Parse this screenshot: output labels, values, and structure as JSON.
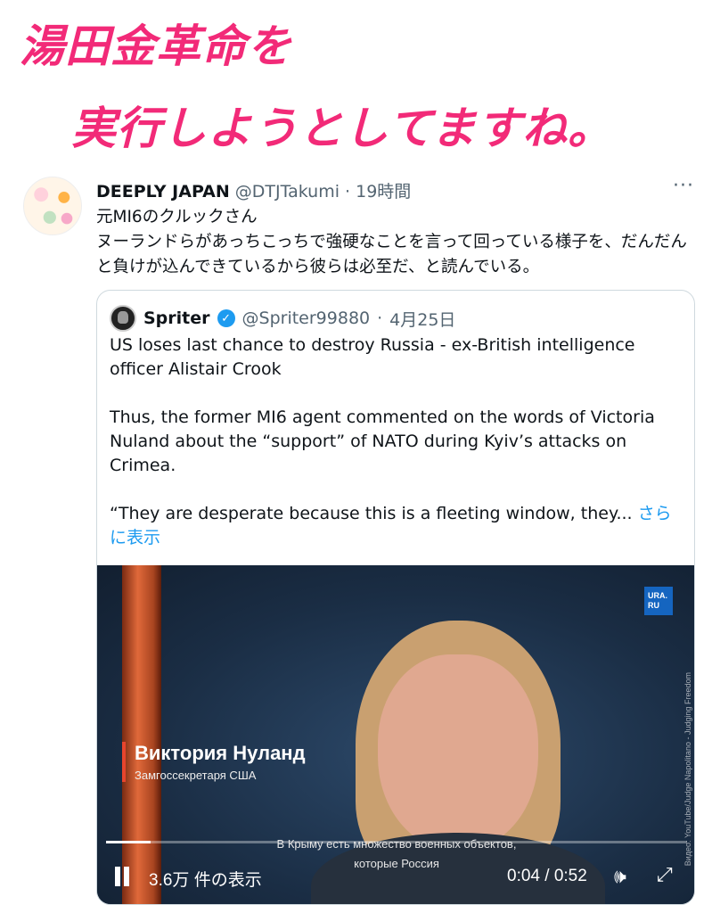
{
  "caption": {
    "line1": "湯田金革命を",
    "line2": "実行しようとしてますね。"
  },
  "tweet": {
    "author_name": "DEEPLY JAPAN",
    "author_handle": "@DTJTakumi",
    "separator": " · ",
    "time": "19時間",
    "more_icon": "···",
    "text_line1": "元MI6のクルックさん",
    "text_line2": "ヌーランドらがあっちこっちで強硬なことを言って回っている様子を、だんだんと負けが込んできているから彼らは必至だ、と読んでいる。"
  },
  "quote": {
    "author_name": "Spriter",
    "author_handle": "@Spriter99880",
    "separator": " · ",
    "date": "4月25日",
    "paragraph1": "US loses last chance to destroy Russia - ex-British intelligence officer Alistair Crook",
    "paragraph2": "Thus, the former MI6 agent commented on the words of Victoria Nuland about the “support” of NATO during Kyiv’s attacks on Crimea.",
    "paragraph3": " “They are desperate because this is a fleeting window, they... ",
    "more_link": "さらに表示"
  },
  "video": {
    "logo_text_1": "URA.",
    "logo_text_2": "RU",
    "lower_third_name": "Виктория Нуланд",
    "lower_third_title": "Замгоссекретаря США",
    "side_credit": "Видео: YouTube/Judge Napolitano - Judging Freedom",
    "subtitle_line1": "В Крыму есть множество военных объектов,",
    "subtitle_line2": "которые Россия",
    "progress_fraction": 0.077,
    "views": "3.6万 件の表示",
    "time": "0:04 / 0:52",
    "volume_icon": "🕪",
    "fullscreen_icon": "⤢"
  },
  "colors": {
    "caption": "#f22a78",
    "link": "#1d9bf0",
    "verified": "#1d9bf0"
  }
}
